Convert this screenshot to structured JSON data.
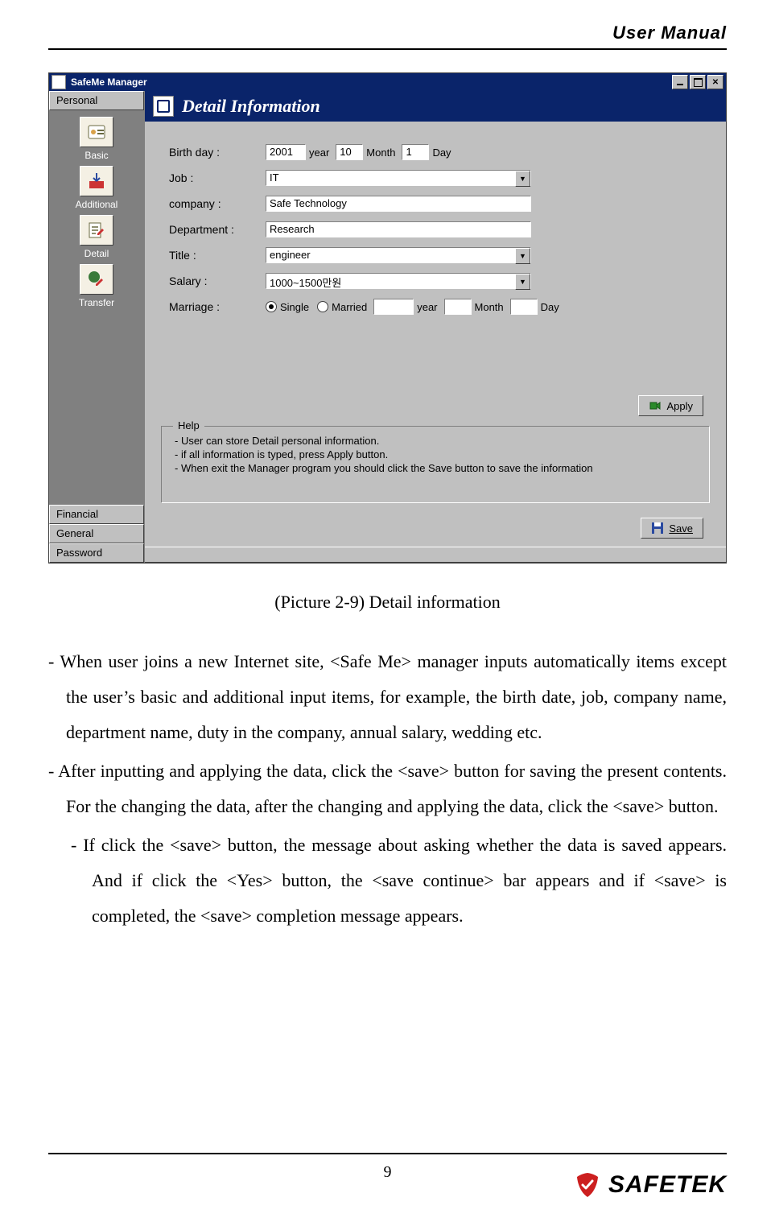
{
  "header": {
    "title": "User Manual"
  },
  "footer": {
    "page_number": "9",
    "brand": "SAFETEK"
  },
  "window": {
    "title": "SafeMe Manager",
    "sidebar_tabs": {
      "personal": "Personal",
      "financial": "Financial",
      "general": "General",
      "password": "Password"
    },
    "sidebar_items": {
      "basic": "Basic",
      "additional": "Additional",
      "detail": "Detail",
      "transfer": "Transfer"
    },
    "banner_title": "Detail Information",
    "labels": {
      "birthday": "Birth day :",
      "job": "Job :",
      "company": "company :",
      "department": "Department :",
      "title": "Title :",
      "salary": "Salary :",
      "marriage": "Marriage :"
    },
    "values": {
      "birth_year": "2001",
      "birth_month": "10",
      "birth_day": "1",
      "job": "IT",
      "company": "Safe Technology",
      "department": "Research",
      "title": "engineer",
      "salary": "1000~1500만원",
      "marriage_year": "",
      "marriage_month": "",
      "marriage_day": ""
    },
    "units": {
      "year": "year",
      "month": "Month",
      "day": "Day"
    },
    "radios": {
      "single": "Single",
      "married": "Married"
    },
    "buttons": {
      "apply": "Apply",
      "save": "Save"
    },
    "help": {
      "legend": "Help",
      "line1": "- User can store Detail personal information.",
      "line2": "- if all information is typed, press Apply button.",
      "line3": "- When exit the Manager program you should click the Save button to save the information"
    }
  },
  "caption": "(Picture 2-9) Detail information",
  "body": {
    "p1": "- When user joins a new Internet site, <Safe Me> manager inputs automatically items except the user’s basic and additional input items, for example, the birth date, job, company name, department name, duty in the company, annual salary, wedding etc.",
    "p2": "- After inputting and applying the data, click the <save> button for saving the present contents. For the changing the data, after the changing and applying the data, click the <save> button.",
    "p3": "-  If click the <save> button, the message about asking whether the data is saved appears. And if click the <Yes> button, the <save continue> bar appears and if <save> is completed, the <save> completion message appears."
  }
}
